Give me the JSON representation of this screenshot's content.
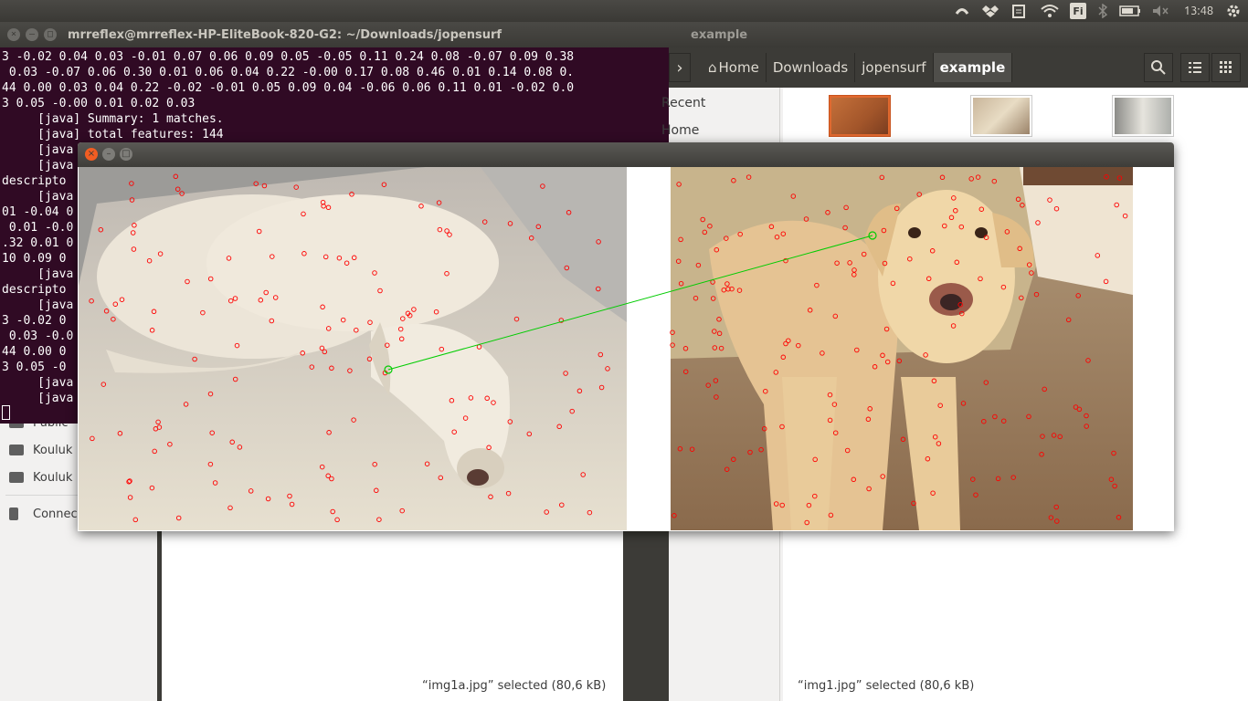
{
  "topbar": {
    "lang": "Fi",
    "clock": "13:48",
    "icons": [
      "dropbox-like-icon",
      "dropbox-icon",
      "clipboard-icon",
      "wifi-icon",
      "keyboard-layout-icon",
      "bluetooth-icon",
      "battery-icon",
      "volume-muted-icon",
      "settings-gear-icon"
    ]
  },
  "terminal": {
    "title": "mrreflex@mrreflex-HP-EliteBook-820-G2: ~/Downloads/jopensurf",
    "lines": [
      "3 -0.02 0.04 0.03 -0.01 0.07 0.06 0.09 0.05 -0.05 0.11 0.24 0.08 -0.07 0.09 0.38",
      " 0.03 -0.07 0.06 0.30 0.01 0.06 0.04 0.22 -0.00 0.17 0.08 0.46 0.01 0.14 0.08 0.",
      "44 0.00 0.03 0.04 0.22 -0.02 -0.01 0.05 0.09 0.04 -0.06 0.06 0.11 0.01 -0.02 0.0",
      "3 0.05 -0.00 0.01 0.02 0.03",
      "     [java] Summary: 1 matches.",
      "     [java] total features: 144",
      "     [java",
      "     [java",
      "descripto",
      "     [java",
      "01 -0.04 0",
      " 0.01 -0.0",
      ".32 0.01 0",
      "10 0.09 0",
      "     [java",
      "descripto",
      "     [java",
      "3 -0.02 0",
      " 0.03 -0.0",
      "44 0.00 0",
      "3 0.05 -0",
      "     [java",
      "     [java"
    ]
  },
  "left_fm": {
    "items": [
      "Public",
      "Kouluk",
      "Kouluk",
      "Connec"
    ],
    "status": "“img1a.jpg” selected  (80,6 kB)"
  },
  "right_fm": {
    "title": "example",
    "crumbs": [
      "Home",
      "Downloads",
      "jopensurf",
      "example"
    ],
    "sidebar": [
      "Recent",
      "Home"
    ],
    "status": "“img1.jpg” selected  (80,6 kB)",
    "colors": {
      "selection": "#e0692f"
    }
  },
  "viewer": {
    "match_color": "#00cc00",
    "feature_color": "#ff0000"
  }
}
